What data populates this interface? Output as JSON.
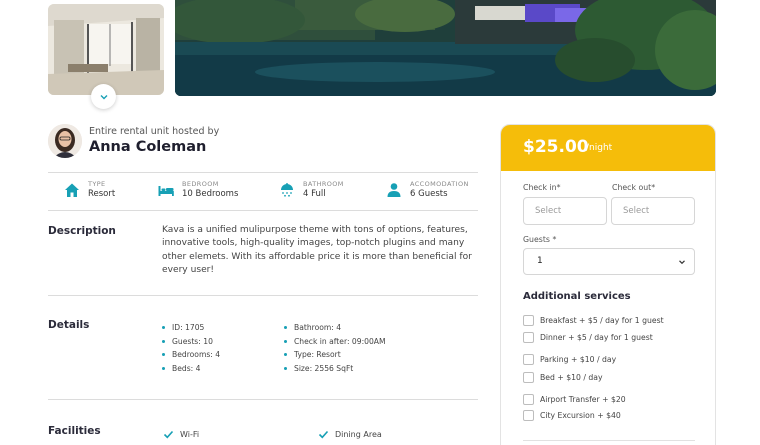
{
  "host": {
    "subtitle": "Entire rental unit hosted by",
    "name": "Anna Coleman"
  },
  "specs": [
    {
      "icon": "home-icon",
      "key": "TYPE",
      "value": "Resort"
    },
    {
      "icon": "bed-icon",
      "key": "BEDROOM",
      "value": "10 Bedrooms"
    },
    {
      "icon": "shower-icon",
      "key": "BATHROOM",
      "value": "4 Full"
    },
    {
      "icon": "person-icon",
      "key": "ACCOMODATION",
      "value": "6 Guests"
    }
  ],
  "description": {
    "title": "Description",
    "text": "Kava is a unified mulipurpose theme with tons of options, features, innovative tools, high-quality images, top-notch plugins and many other elemets. With its affordable price it is more than beneficial for every user!"
  },
  "details": {
    "title": "Details",
    "left": [
      "ID: 1705",
      "Guests: 10",
      "Bedrooms: 4",
      "Beds: 4"
    ],
    "right": [
      "Bathroom: 4",
      "Check in after: 09:00AM",
      "Type: Resort",
      "Size: 2556 SqFt"
    ]
  },
  "facilities": {
    "title": "Facilities",
    "items": [
      "Wi-Fi",
      "Dining Area"
    ]
  },
  "booking": {
    "price": "$25.00",
    "per": "/night",
    "checkin_label": "Check in*",
    "checkout_label": "Check out*",
    "checkin_placeholder": "Select",
    "checkout_placeholder": "Select",
    "guests_label": "Guests *",
    "guests_value": "1",
    "additional_title": "Additional services",
    "services": [
      "Breakfast + $5 / day for 1 guest",
      "Dinner + $5 / day for 1 guest",
      "Parking + $10 / day",
      "Bed + $10 / day",
      "Airport Transfer + $20",
      "City Excursion + $40"
    ]
  },
  "colors": {
    "accent": "#17a0b5",
    "price_band": "#f5bd0a"
  }
}
